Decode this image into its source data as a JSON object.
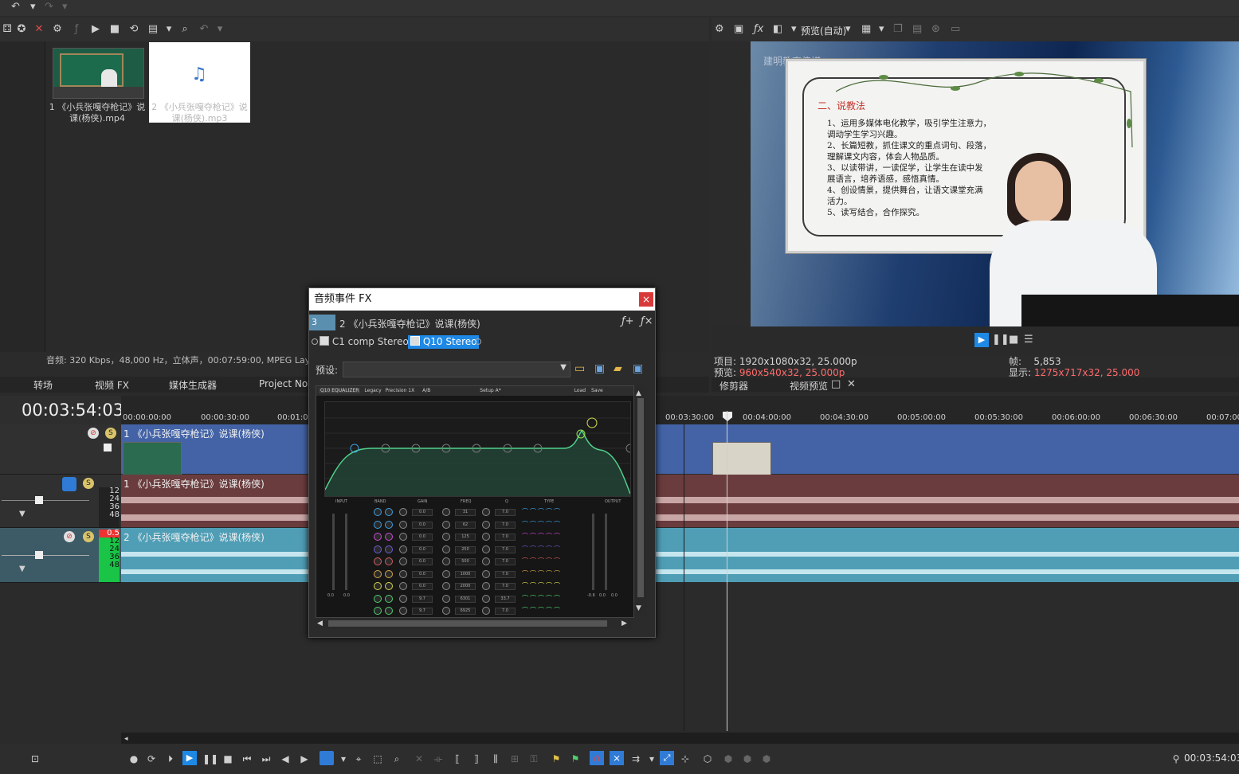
{
  "media": {
    "items": [
      {
        "label": "1 《小兵张嘎夺枪记》说课(杨侠).mp4"
      },
      {
        "label": "2 《小兵张嘎夺枪记》说课(杨侠).mp3"
      }
    ],
    "status": "音频: 320 Kbps，48,000 Hz，立体声，00:07:59:00, MPEG Laye"
  },
  "tabs": [
    "转场",
    "视频 FX",
    "媒体生成器",
    "Project Note"
  ],
  "preview": {
    "dropdown": "预览(自动)",
    "watermark": "建明教育传媒",
    "board_title": "二、说教法",
    "board_lines": [
      "1、运用多媒体电化教学，吸引学生注意力，",
      "调动学生学习兴趣。",
      "2、长篇短教，抓住课文的重点词句、段落，",
      "理解课文内容，体会人物品质。",
      "3、以读带讲，一读促学，让学生在读中发",
      "展语言，培养语感，感悟真情。",
      "4、创设情景，提供舞台，让语文课堂充满",
      "活力。",
      "5、读写结合，合作探究。"
    ],
    "project_label": "项目:",
    "project_value": "1920x1080x32, 25.000p",
    "preview_label": "预览:",
    "preview_value": "960x540x32, 25.000p",
    "frame_label": "帧:",
    "frame_value": "5,853",
    "display_label": "显示:",
    "display_value": "1275x717x32, 25.000",
    "tab_trimmer": "修剪器",
    "tab_video_preview": "视频预览"
  },
  "timeline": {
    "timecode": "00:03:54:03",
    "ruler_left": [
      "00:00:00:00",
      "00:00:30:00",
      "00:01:00"
    ],
    "ruler_right": [
      "00:03:30:00",
      "00:04:00:00",
      "00:04:30:00",
      "00:05:00:00",
      "00:05:30:00",
      "00:06:00:00",
      "00:06:30:00",
      "00:07:00"
    ],
    "video_track_title": "1 《小兵张嘎夺枪记》说课(杨侠)",
    "audio_track1_title": "1 《小兵张嘎夺枪记》说课(杨侠)",
    "audio_track2_title": "2 《小兵张嘎夺枪记》说课(杨侠)",
    "meter_labels": [
      "12",
      "24",
      "36",
      "48"
    ],
    "meter_peak": "0.5",
    "bottom_timecode": "00:03:54:03"
  },
  "dialog": {
    "title": "音频事件 FX",
    "close": "×",
    "event_number": "3",
    "event_name": "2 《小兵张嘎夺枪记》说课(杨侠)",
    "plugin1": "C1 comp Stereo",
    "plugin2": "Q10 Stereo",
    "preset_label": "预设:",
    "preset_value": "",
    "eq_name": "Q10 EQUALIZER",
    "eq_tabs": [
      "Legacy",
      "Precision 1X",
      "A/B",
      "Setup A*",
      "Load",
      "Save"
    ],
    "section_labels": [
      "INPUT",
      "BAND",
      "GAIN",
      "FREQ",
      "Q",
      "TYPE",
      "OUTPUT"
    ],
    "gains": [
      "0.0",
      "0.0",
      "0.0",
      "0.0",
      "0.0",
      "0.0",
      "0.0",
      "9.7",
      "9.7"
    ],
    "freqs": [
      "31",
      "62",
      "125",
      "250",
      "500",
      "1000",
      "2000",
      "6301",
      "6925"
    ],
    "qs": [
      "7.0",
      "7.0",
      "7.0",
      "7.0",
      "7.0",
      "7.0",
      "7.0",
      "33.7",
      "7.0"
    ],
    "graph_freq_labels": [
      "31",
      "62",
      "125",
      "250",
      "500",
      "1k",
      "2k",
      "4k",
      "8k",
      "16k"
    ],
    "graph_gain_labels": [
      "18",
      "12",
      "6",
      "0",
      "-6",
      "-12",
      "-18"
    ],
    "input_values": [
      "0.0",
      "0.0"
    ],
    "output_values": [
      "-0.6",
      "0.0",
      "0.0"
    ]
  }
}
